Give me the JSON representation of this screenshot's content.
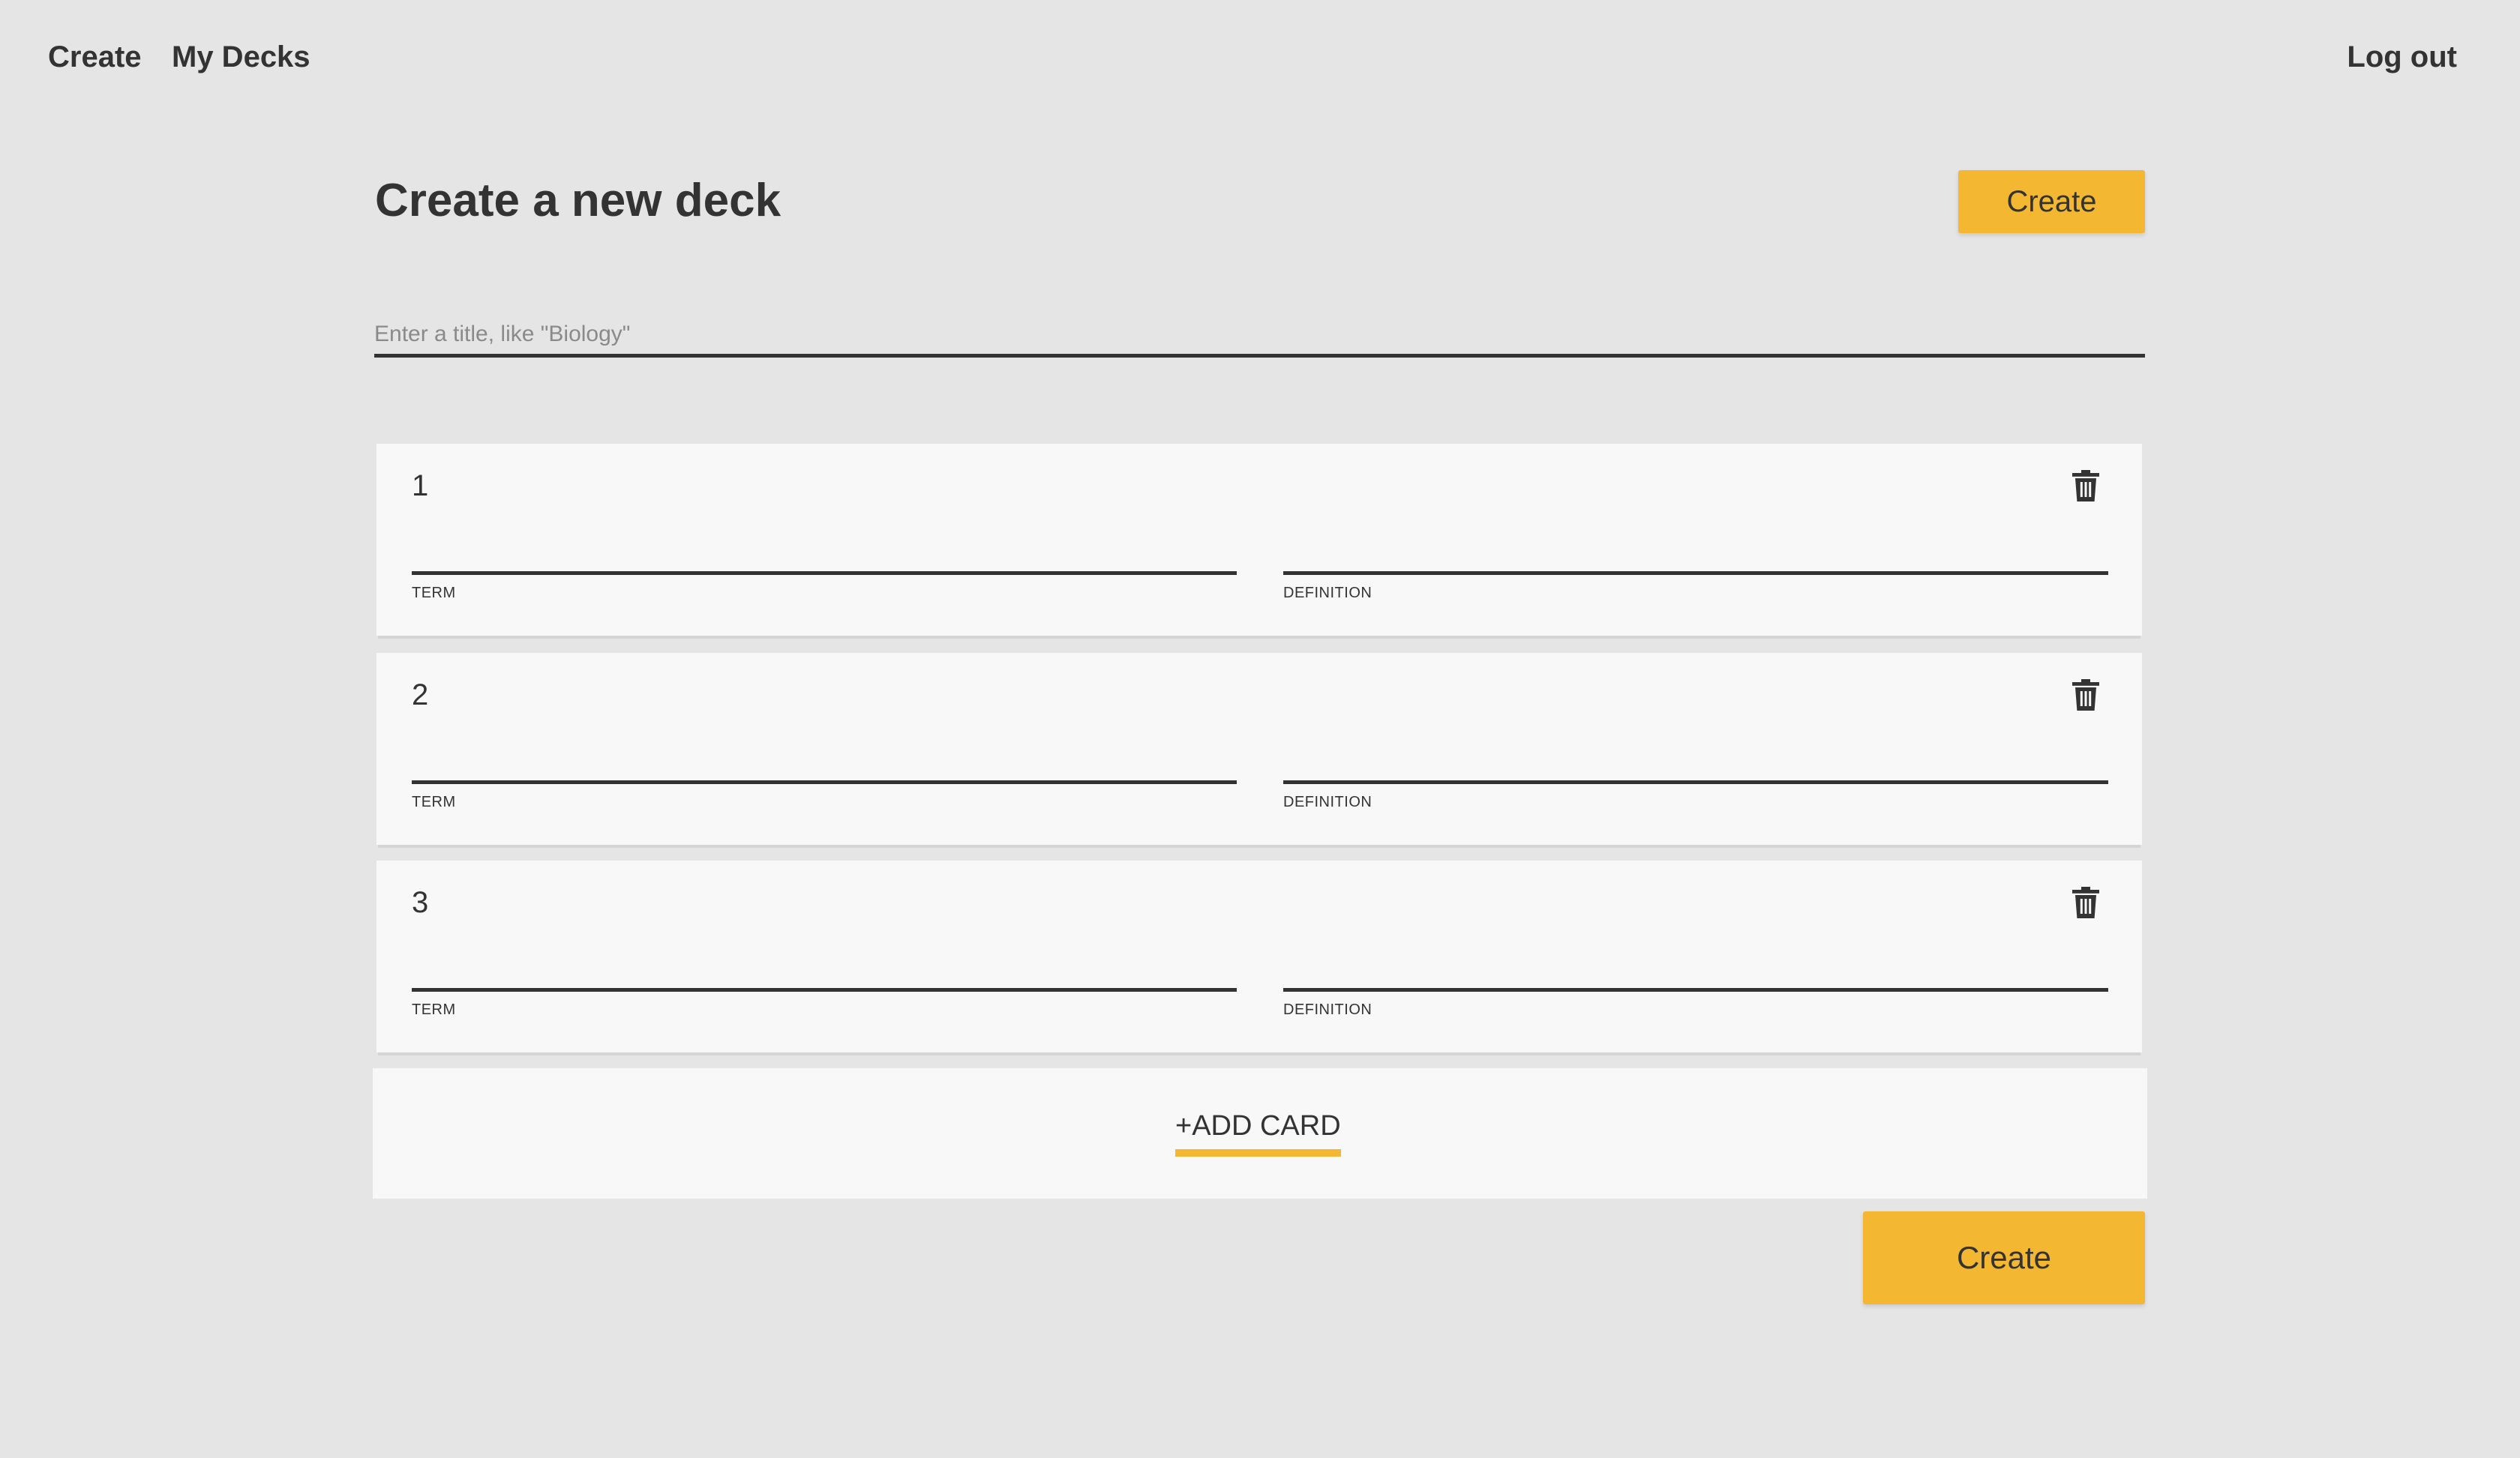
{
  "nav": {
    "create": "Create",
    "my_decks": "My Decks",
    "logout": "Log out"
  },
  "header": {
    "title": "Create a new deck",
    "create_button": "Create"
  },
  "title_input": {
    "placeholder": "Enter a title, like \"Biology\"",
    "value": ""
  },
  "cards": [
    {
      "number": "1",
      "term_label": "TERM",
      "definition_label": "DEFINITION",
      "term": "",
      "definition": ""
    },
    {
      "number": "2",
      "term_label": "TERM",
      "definition_label": "DEFINITION",
      "term": "",
      "definition": ""
    },
    {
      "number": "3",
      "term_label": "TERM",
      "definition_label": "DEFINITION",
      "term": "",
      "definition": ""
    }
  ],
  "add_card": {
    "icon": "plus-icon",
    "label": "+ADD CARD"
  },
  "footer": {
    "create_button": "Create"
  },
  "icons": {
    "delete": "trash-icon"
  },
  "colors": {
    "background": "#e5e5e5",
    "card": "#f8f8f8",
    "accent": "#f4b731",
    "text": "#333333"
  }
}
